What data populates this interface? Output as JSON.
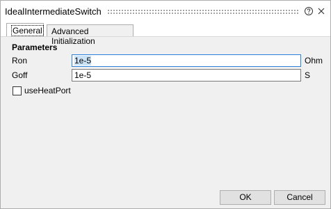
{
  "window": {
    "title": "IdealIntermediateSwitch",
    "help_icon": "help-circle-icon",
    "close_icon": "close-icon"
  },
  "tabs": [
    {
      "label": "General",
      "selected": true
    },
    {
      "label": "Advanced Initialization",
      "selected": false
    }
  ],
  "parameters": {
    "section_title": "Parameters",
    "rows": [
      {
        "label": "Ron",
        "value": "1e-5",
        "unit": "Ohm"
      },
      {
        "label": "Goff",
        "value": "1e-5",
        "unit": "S"
      }
    ]
  },
  "options": {
    "use_heat_port": {
      "label": "useHeatPort",
      "checked": false
    }
  },
  "footer": {
    "ok_label": "OK",
    "cancel_label": "Cancel"
  },
  "colors": {
    "accent": "#2c7fd6",
    "selection": "#cce4f7"
  }
}
